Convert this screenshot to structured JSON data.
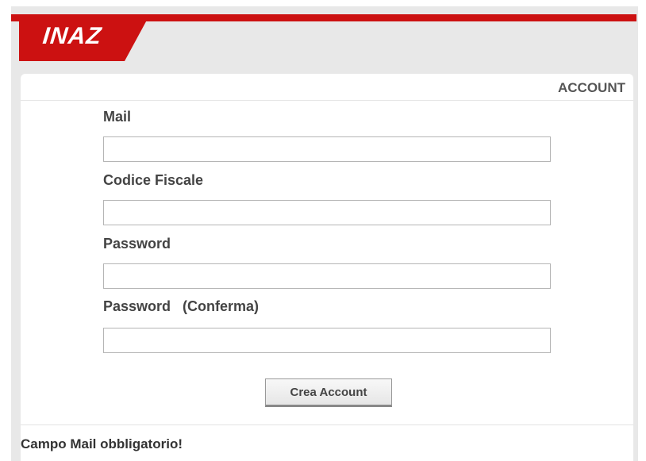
{
  "brand": {
    "logo_text": "INAZ",
    "accent_color": "#cc1111"
  },
  "panel": {
    "title": "ACCOUNT"
  },
  "form": {
    "fields": [
      {
        "label": "Mail",
        "value": "",
        "placeholder": ""
      },
      {
        "label": "Codice Fiscale",
        "value": "",
        "placeholder": ""
      },
      {
        "label": "Password",
        "value": "",
        "placeholder": ""
      },
      {
        "label": "Password   (Conferma)",
        "value": "",
        "placeholder": ""
      }
    ],
    "submit_label": "Crea Account"
  },
  "status": {
    "message": "Campo Mail obbligatorio!"
  }
}
